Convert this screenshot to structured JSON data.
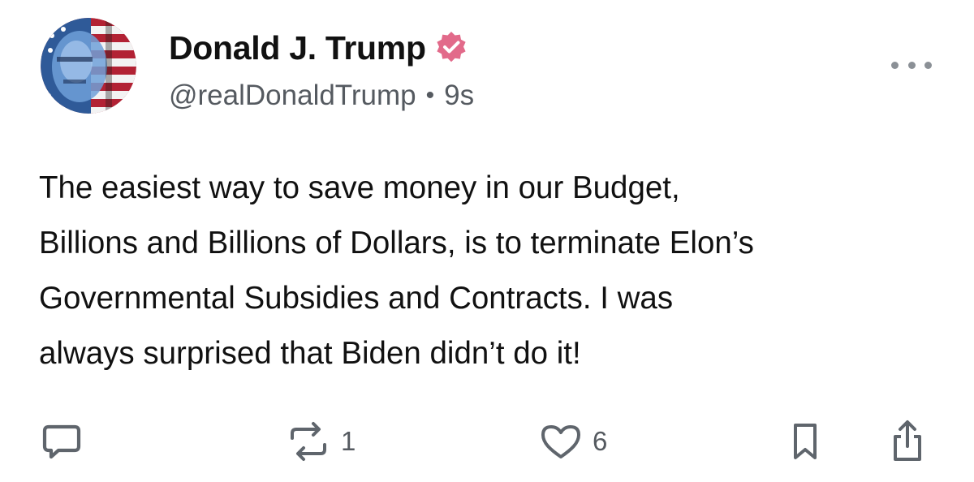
{
  "author": {
    "display_name": "Donald J. Trump",
    "handle": "@realDonaldTrump",
    "separator": "•",
    "time": "9s",
    "verified": true,
    "verified_color": "#e26a8a"
  },
  "post": {
    "text": "The easiest way to save money in our Budget,\nBillions and Billions of Dollars, is to terminate Elon’s\nGovernmental Subsidies and Contracts. I was\nalways surprised that Biden didn’t do it!"
  },
  "actions": {
    "reply_icon": "reply-icon",
    "repost_icon": "repost-icon",
    "repost_count": "1",
    "like_icon": "heart-icon",
    "like_count": "6",
    "bookmark_icon": "bookmark-icon",
    "share_icon": "share-icon"
  },
  "menu": {
    "icon": "more-options-icon"
  }
}
